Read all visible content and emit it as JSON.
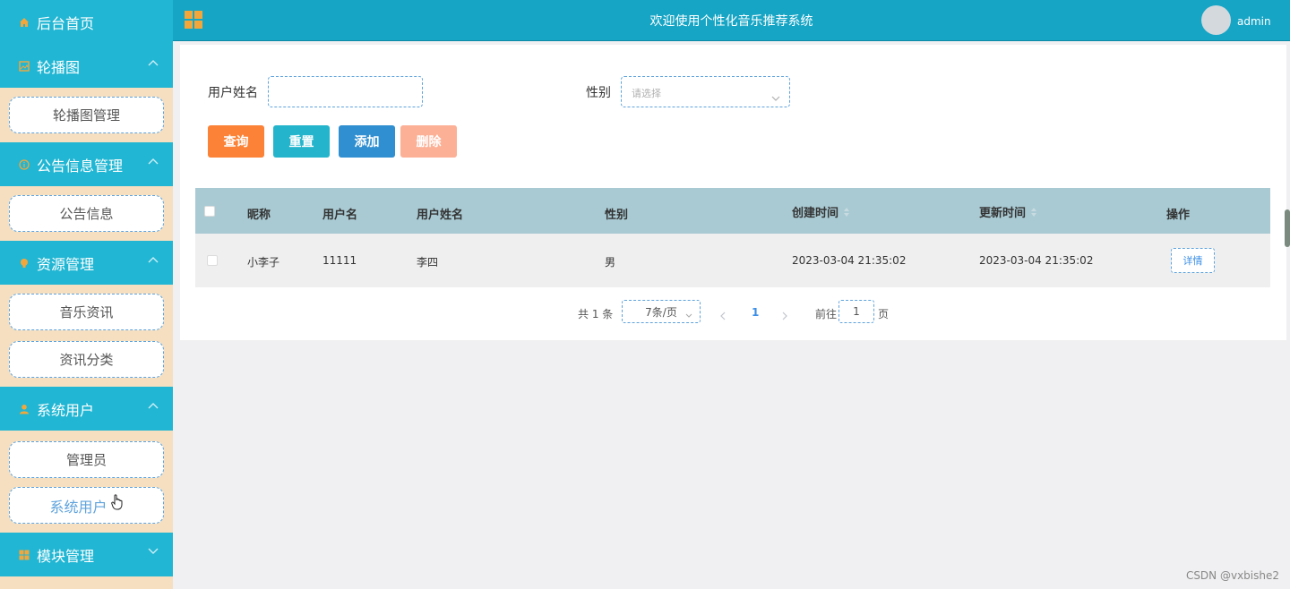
{
  "sidebar": {
    "home": "后台首页",
    "groups": [
      {
        "label": "轮播图",
        "icon": "image-icon",
        "items": [
          "轮播图管理"
        ]
      },
      {
        "label": "公告信息管理",
        "icon": "info-icon",
        "items": [
          "公告信息"
        ]
      },
      {
        "label": "资源管理",
        "icon": "bulb-icon",
        "items": [
          "音乐资讯",
          "资讯分类"
        ]
      },
      {
        "label": "系统用户",
        "icon": "user-icon",
        "items": [
          "管理员",
          "系统用户"
        ]
      },
      {
        "label": "模块管理",
        "icon": "grid-icon",
        "items": []
      }
    ],
    "active_item": "系统用户"
  },
  "topbar": {
    "title": "欢迎使用个性化音乐推荐系统",
    "user": "admin"
  },
  "search": {
    "name_label": "用户姓名",
    "name_value": "",
    "gender_label": "性别",
    "gender_placeholder": "请选择"
  },
  "buttons": {
    "query": "查询",
    "reset": "重置",
    "add": "添加",
    "delete": "删除",
    "colors": {
      "query": "#fb8236",
      "reset": "#24b5cc",
      "add": "#2f8fd0",
      "delete": "#fcb096"
    }
  },
  "table": {
    "headers": [
      "昵称",
      "用户名",
      "用户姓名",
      "性别",
      "创建时间",
      "更新时间",
      "操作"
    ],
    "rows": [
      {
        "nickname": "小李子",
        "username": "11111",
        "realname": "李四",
        "gender": "男",
        "created": "2023-03-04 21:35:02",
        "updated": "2023-03-04 21:35:02",
        "action": "详情"
      }
    ]
  },
  "pagination": {
    "total": "共 1 条",
    "page_size": "7条/页",
    "current": "1",
    "goto_label": "前往",
    "goto_value": "1",
    "page_unit": "页"
  },
  "watermark": "CSDN @vxbishe2"
}
